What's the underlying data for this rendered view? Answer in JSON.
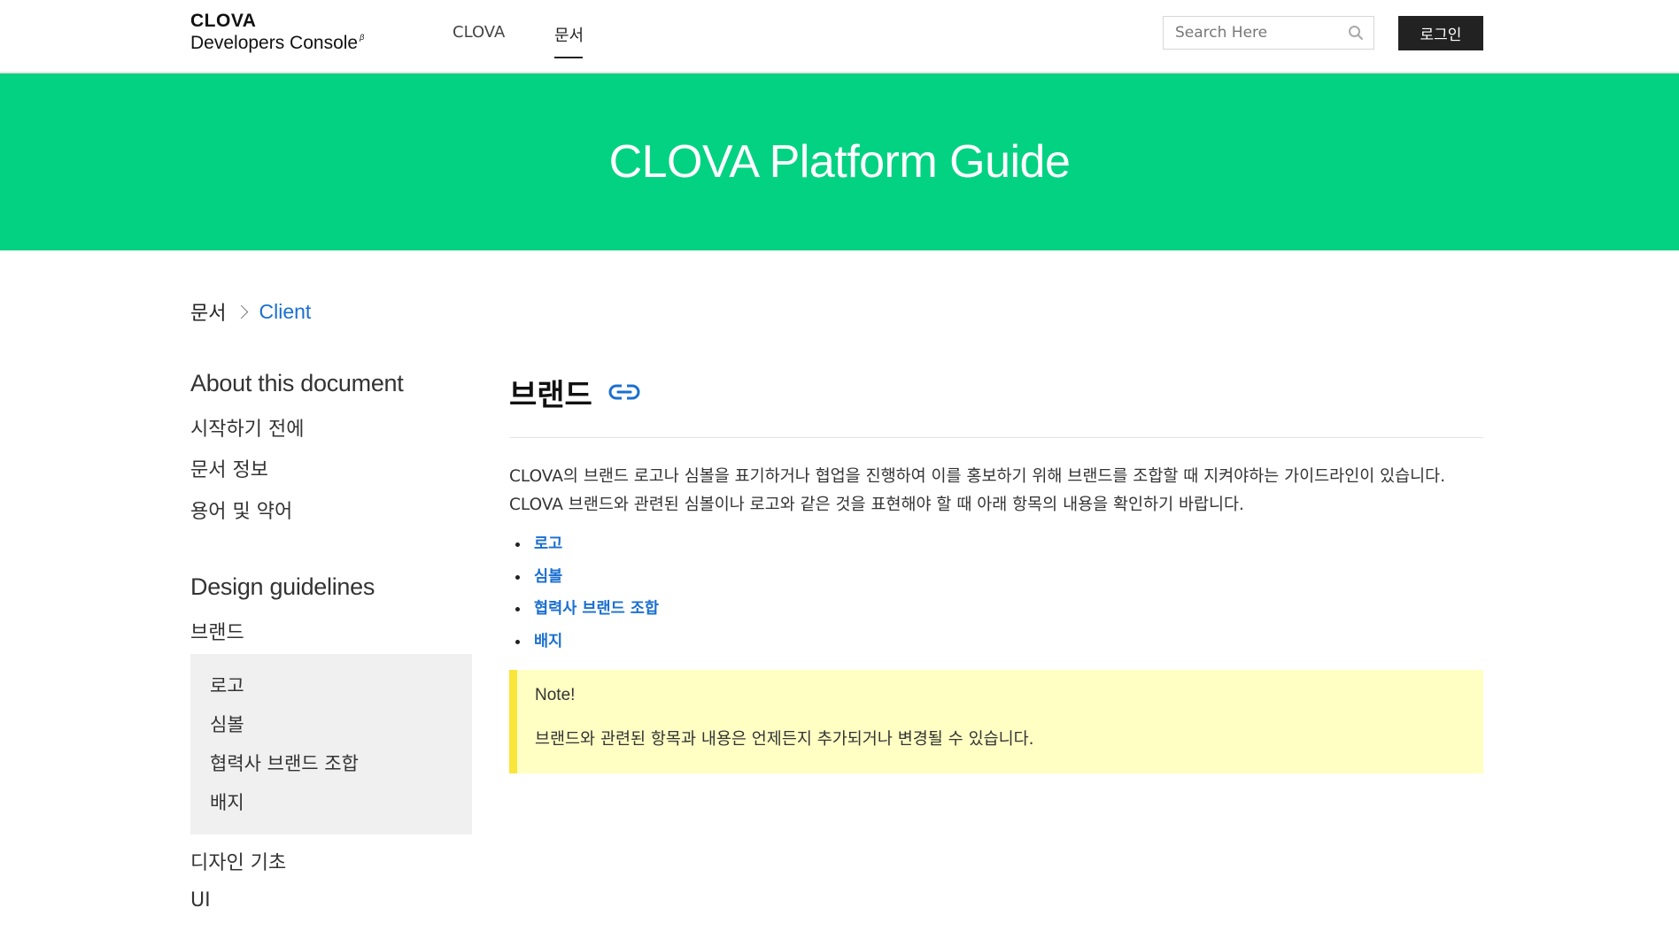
{
  "header": {
    "logo_top": "CLOVA",
    "logo_bottom": "Developers Console",
    "logo_beta": "β",
    "nav": [
      {
        "label": "CLOVA"
      },
      {
        "label": "문서"
      }
    ],
    "search_placeholder": "Search Here",
    "login_label": "로그인"
  },
  "hero": {
    "title": "CLOVA Platform Guide"
  },
  "breadcrumb": {
    "root": "문서",
    "current": "Client"
  },
  "sidebar": {
    "section1": {
      "heading": "About this document",
      "items": [
        "시작하기 전에",
        "문서 정보",
        "용어 및 약어"
      ]
    },
    "section2": {
      "heading": "Design guidelines",
      "active_item": "브랜드",
      "subitems": [
        "로고",
        "심볼",
        "협력사 브랜드 조합",
        "배지"
      ],
      "items_after": [
        "디자인 기초",
        "UI"
      ]
    }
  },
  "content": {
    "title": "브랜드",
    "paragraph_line1": "CLOVA의 브랜드 로고나 심볼을 표기하거나 협업을 진행하여 이를 홍보하기 위해 브랜드를 조합할 때 지켜야하는 가이드라인이 있습니다.",
    "paragraph_line2": "CLOVA 브랜드와 관련된 심볼이나 로고와 같은 것을 표현해야 할 때 아래 항목의 내용을 확인하기 바랍니다.",
    "toc": [
      "로고",
      "심볼",
      "협력사 브랜드 조합",
      "배지"
    ],
    "note": {
      "title": "Note!",
      "body": "브랜드와 관련된 항목과 내용은 언제든지 추가되거나 변경될 수 있습니다."
    }
  },
  "colors": {
    "hero_bg": "#03d282",
    "link": "#1a6fd0",
    "note_bg": "#ffffc4",
    "note_border": "#fae53a",
    "login_bg": "#222222"
  },
  "icons": {
    "search": "search-icon",
    "anchor": "link-icon",
    "breadcrumb_separator": "chevron-right-icon"
  }
}
